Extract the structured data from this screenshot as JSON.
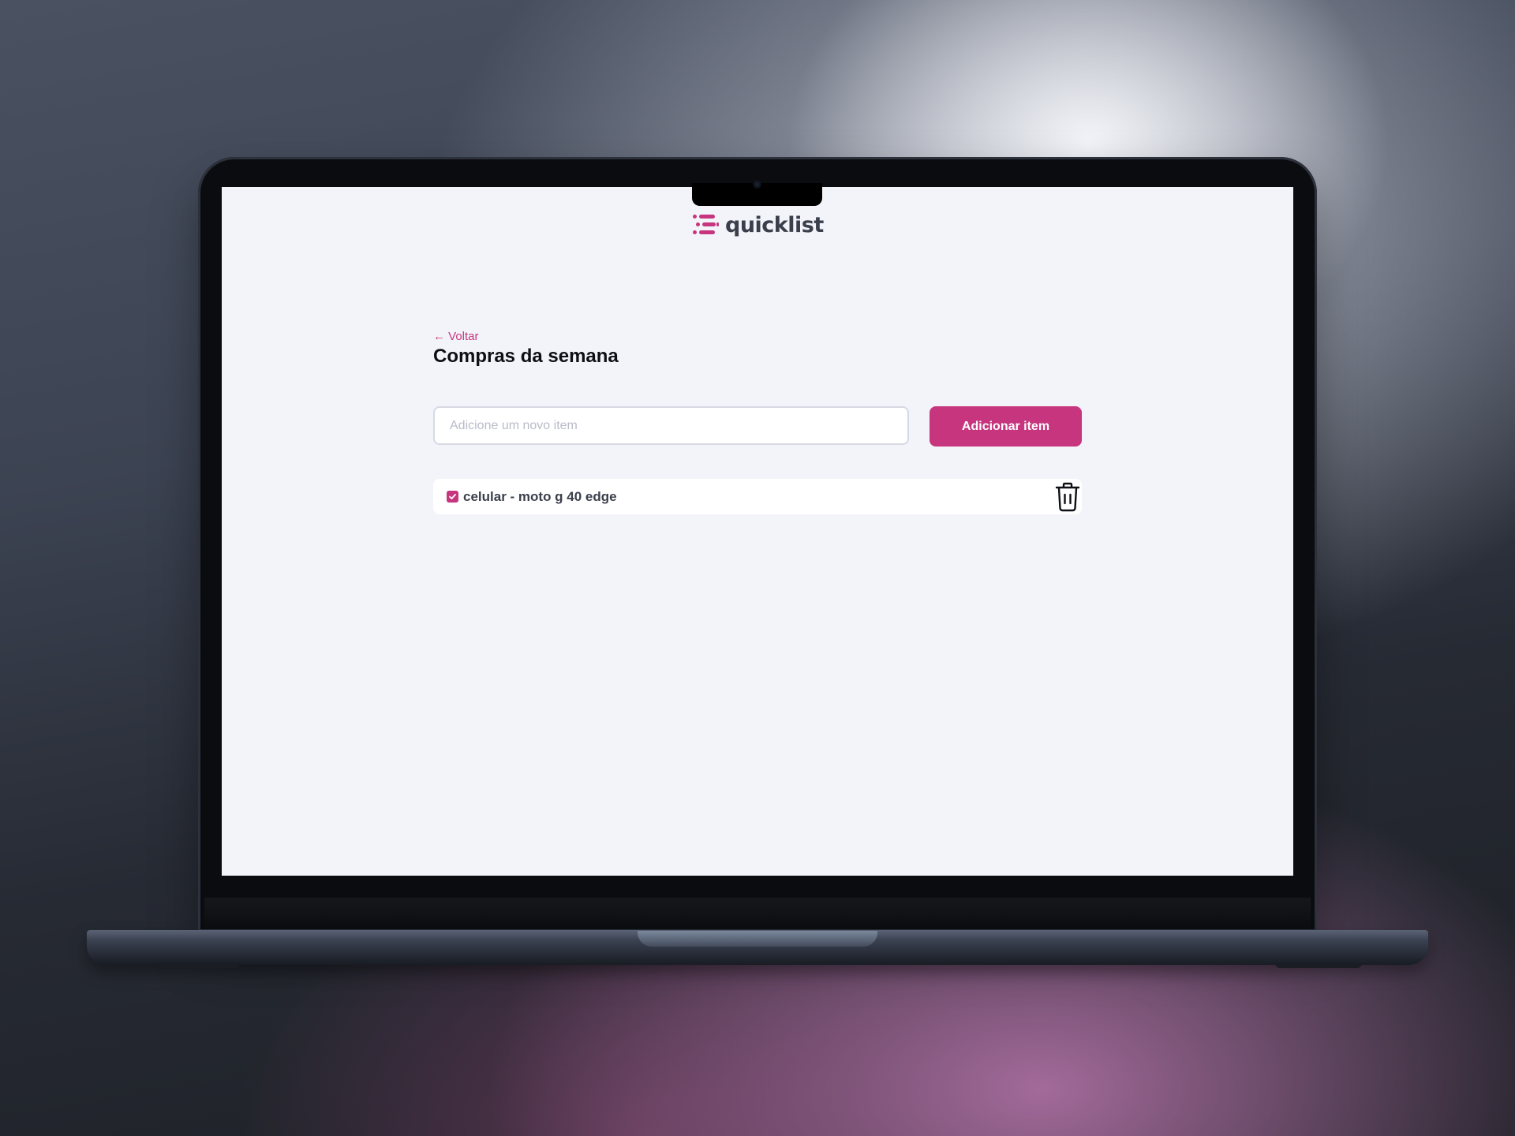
{
  "app": {
    "brand": "quicklist",
    "accent_color": "#c6357e"
  },
  "header": {
    "back_label": "← Voltar",
    "title": "Compras da semana"
  },
  "add_form": {
    "input_placeholder": "Adicione um novo item",
    "input_value": "",
    "button_label": "Adicionar item"
  },
  "items": [
    {
      "label": "celular - moto g 40 edge",
      "checked": true,
      "delete_icon": "trash-icon"
    }
  ]
}
